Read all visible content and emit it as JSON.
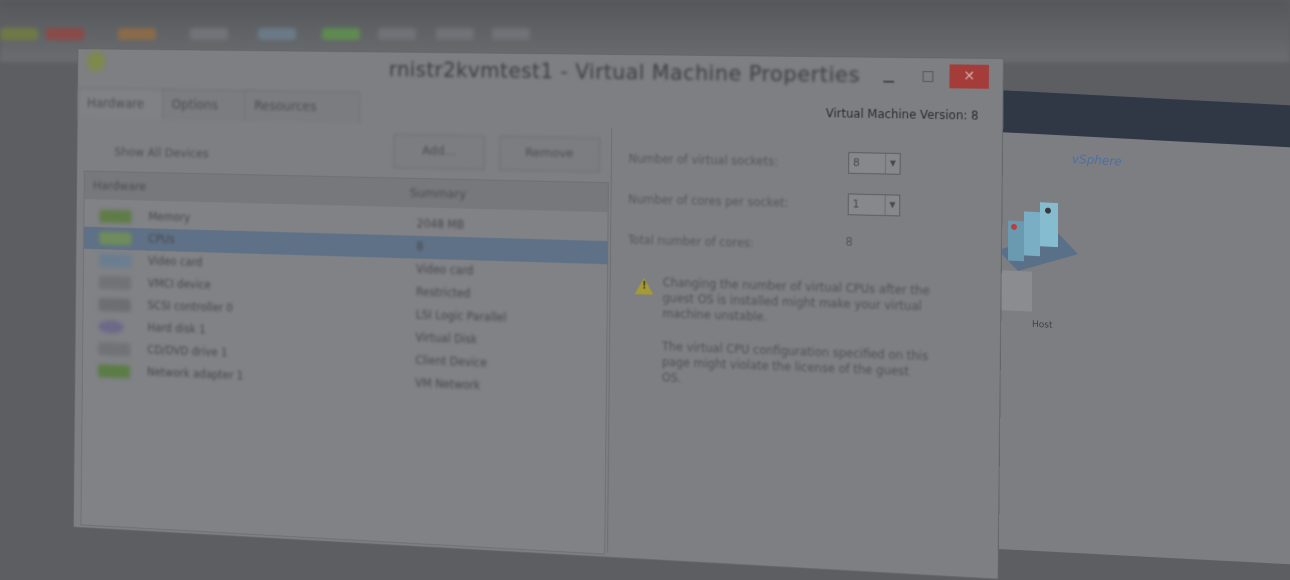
{
  "toolbar": {
    "labels": [
      "",
      ""
    ],
    "icon_colors": [
      "#6d7a45",
      "#8a4a48",
      "#8a6a4a",
      "#707478",
      "#6a7a86",
      "#5f8a52",
      "#6f7276",
      "#6f7276",
      "#6f7276"
    ]
  },
  "dialog": {
    "title": "rnistr2kvmtest1 - Virtual Machine Properties",
    "version_label": "Virtual Machine Version: 8",
    "tabs": [
      "Hardware",
      "Options",
      "Resources"
    ],
    "show_all_devices": "Show All Devices",
    "add_button": "Add...",
    "remove_button": "Remove",
    "hardware": {
      "columns": [
        "Hardware",
        "Summary"
      ],
      "rows": [
        {
          "name": "Memory",
          "summary": "2048 MB",
          "icon_color": "#5f7c48"
        },
        {
          "name": "CPUs",
          "summary": "8",
          "icon_color": "#6f8c5c",
          "selected": true
        },
        {
          "name": "Video card",
          "summary": "Video card",
          "icon_color": "#6a7e90"
        },
        {
          "name": "VMCI device",
          "summary": "Restricted",
          "icon_color": "#707276"
        },
        {
          "name": "SCSI controller 0",
          "summary": "LSI Logic Parallel",
          "icon_color": "#6c6e72"
        },
        {
          "name": "Hard disk 1",
          "summary": "Virtual Disk",
          "icon_color": "#6a6a88"
        },
        {
          "name": "CD/DVD drive 1",
          "summary": "Client Device",
          "icon_color": "#707276"
        },
        {
          "name": "Network adapter 1",
          "summary": "VM Network",
          "icon_color": "#5c7c46"
        }
      ]
    },
    "cpu": {
      "sockets_label": "Number of virtual sockets:",
      "sockets_value": "8",
      "cores_label": "Number of cores per socket:",
      "cores_value": "1",
      "total_label": "Total number of cores:",
      "total_value": "8",
      "warning": "Changing the number of virtual CPUs after the guest OS is installed might make your virtual machine unstable.",
      "license_note": "The virtual CPU configuration specified on this page might violate the license of the guest OS."
    }
  },
  "back_window": {
    "logo": "vSphere",
    "caption": "Host",
    "status": ""
  }
}
